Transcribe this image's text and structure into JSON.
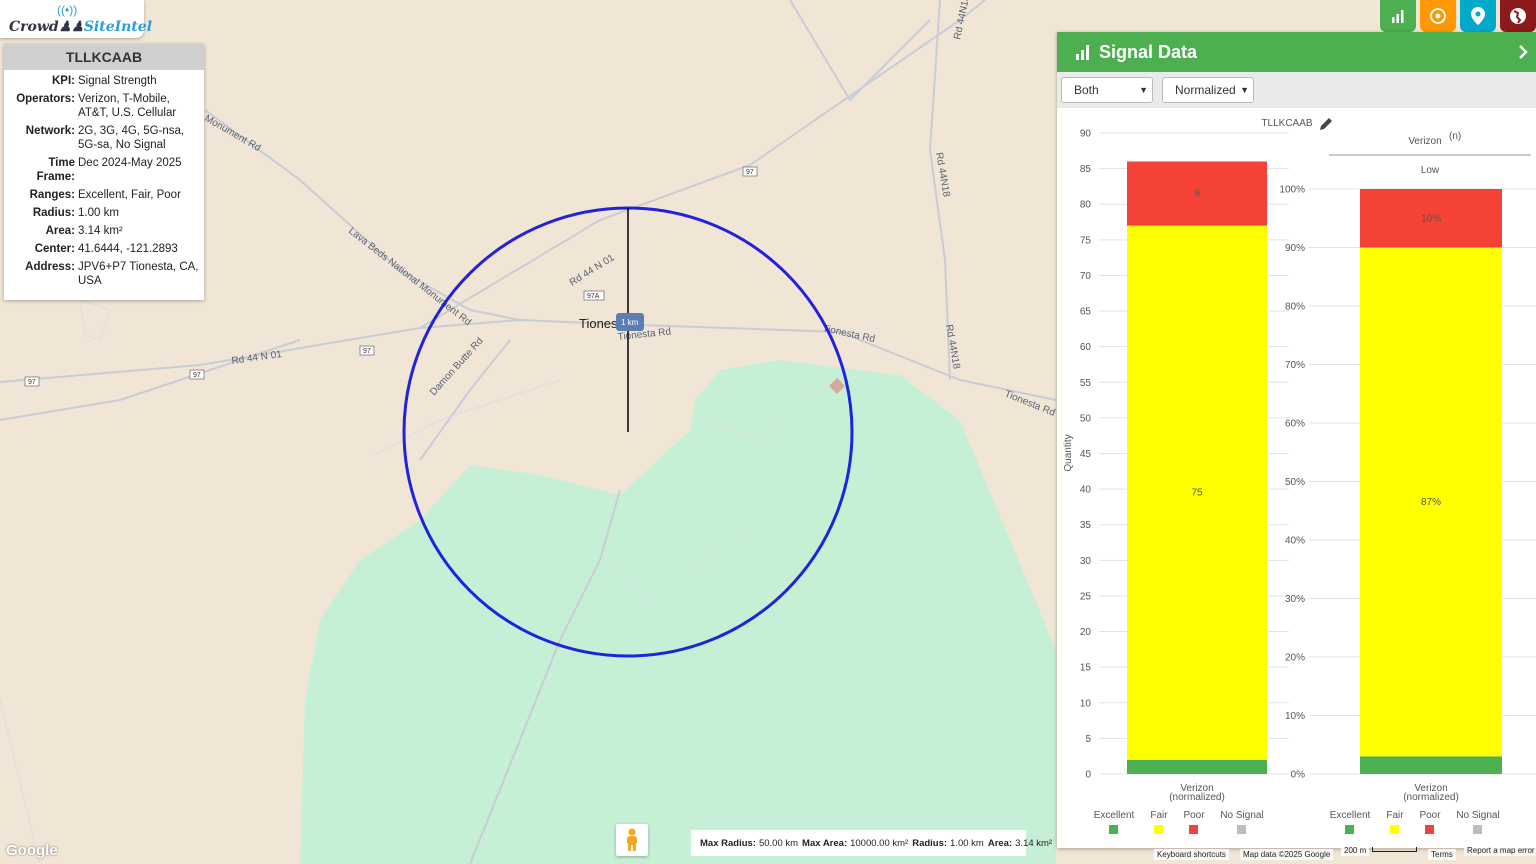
{
  "app": {
    "logo_text_a": "Crowd",
    "logo_text_b": "SiteIntel"
  },
  "info": {
    "title": "TLLKCAAB",
    "rows": [
      {
        "k": "KPI:",
        "v": "Signal Strength"
      },
      {
        "k": "Operators:",
        "v": "Verizon, T-Mobile, AT&T, U.S. Cellular"
      },
      {
        "k": "Network:",
        "v": "2G, 3G, 4G, 5G-nsa, 5G-sa, No Signal"
      },
      {
        "k": "Time Frame:",
        "v": "Dec 2024-May 2025"
      },
      {
        "k": "Ranges:",
        "v": "Excellent, Fair, Poor"
      },
      {
        "k": "Radius:",
        "v": "1.00 km"
      },
      {
        "k": "Area:",
        "v": "3.14 km²"
      },
      {
        "k": "Center:",
        "v": "41.6444, -121.2893"
      },
      {
        "k": "Address:",
        "v": "JPV6+P7 Tionesta, CA, USA"
      }
    ]
  },
  "map": {
    "place_label": "Tionesta",
    "radius_marker": "1 km",
    "roads": [
      "Rd 44 N 01",
      "Rd 44 N 01",
      "Lava Beds National Monument Rd",
      "Monument Rd",
      "Damon Butte Rd",
      "Tionesta Rd",
      "Tionesta Rd",
      "Tionesta Rd",
      "Rd 44N18",
      "Rd 44N18",
      "Rd 44N18"
    ],
    "shields": [
      "97",
      "97",
      "97",
      "97",
      "97A"
    ]
  },
  "toolbar": {
    "icons": [
      "chart-icon",
      "target-icon",
      "pin-icon",
      "globe-icon"
    ],
    "colors": [
      "#4caf50",
      "#ff9800",
      "#03a9c9",
      "#8b1a1a"
    ]
  },
  "panel": {
    "title": "Signal Data",
    "filter_select": "Both",
    "mode_select": "Normalized"
  },
  "chart_data": [
    {
      "type": "bar",
      "title": "TLLKCAAB",
      "ylabel": "Quantity",
      "ylim": [
        0,
        90
      ],
      "yticks": [
        0,
        5,
        10,
        15,
        20,
        25,
        30,
        35,
        40,
        45,
        50,
        55,
        60,
        65,
        70,
        75,
        80,
        85,
        90
      ],
      "categories": [
        "Verizon (normalized)"
      ],
      "series": [
        {
          "name": "Excellent",
          "values": [
            2
          ],
          "color": "#4caf50"
        },
        {
          "name": "Fair",
          "values": [
            75
          ],
          "color": "#ffff00"
        },
        {
          "name": "Poor",
          "values": [
            9
          ],
          "color": "#f44336"
        },
        {
          "name": "No Signal",
          "values": [
            0
          ],
          "color": "#bdbdbd"
        }
      ],
      "data_labels": [
        "9",
        "75"
      ],
      "legend": "bottom"
    },
    {
      "type": "bar",
      "title": "Verizon",
      "title_sup": "(n)",
      "subtitle": "Low",
      "ylim": [
        0,
        100
      ],
      "yticks": [
        "0%",
        "10%",
        "20%",
        "30%",
        "40%",
        "50%",
        "60%",
        "70%",
        "80%",
        "90%",
        "100%"
      ],
      "categories": [
        "Verizon (normalized)"
      ],
      "series": [
        {
          "name": "Excellent",
          "values": [
            3
          ],
          "color": "#4caf50"
        },
        {
          "name": "Fair",
          "values": [
            87
          ],
          "color": "#ffff00"
        },
        {
          "name": "Poor",
          "values": [
            10
          ],
          "color": "#f44336"
        },
        {
          "name": "No Signal",
          "values": [
            0
          ],
          "color": "#bdbdbd"
        }
      ],
      "data_labels": [
        "10%",
        "87%"
      ],
      "legend": "bottom"
    }
  ],
  "statusbar": {
    "max_radius_k": "Max Radius:",
    "max_radius_v": "50.00 km",
    "max_area_k": "Max Area:",
    "max_area_v": "10000.00 km²",
    "radius_k": "Radius:",
    "radius_v": "1.00 km",
    "area_k": "Area:",
    "area_v": "3.14 km²"
  },
  "footer": {
    "keyboard": "Keyboard shortcuts",
    "mapdata": "Map data ©2025 Google",
    "scale": "200 m",
    "terms": "Terms",
    "report": "Report a map error",
    "brand": "Google"
  }
}
